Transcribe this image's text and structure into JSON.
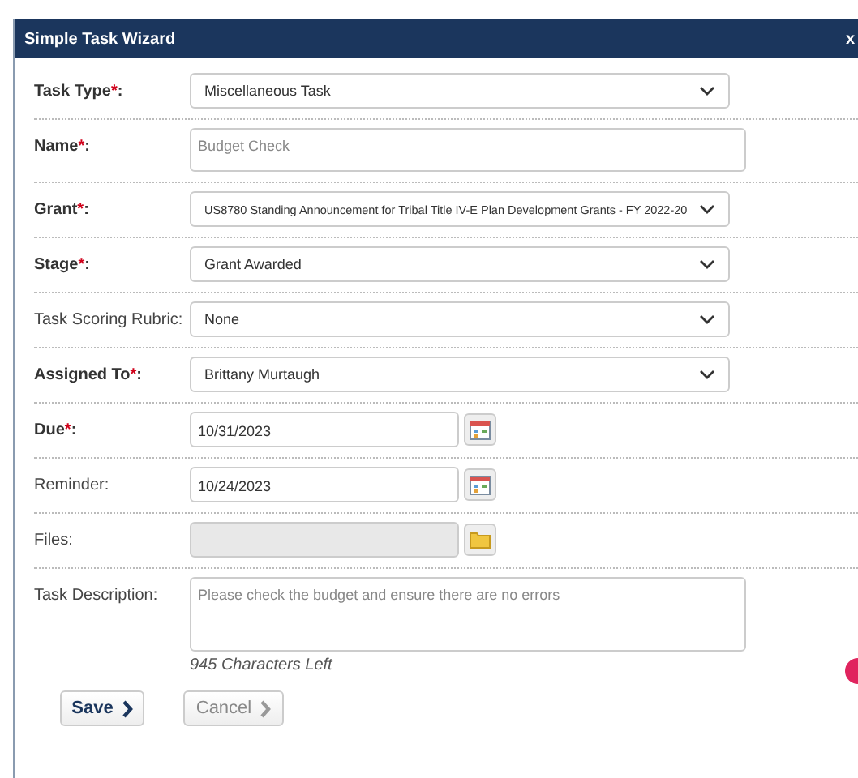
{
  "dialog": {
    "title": "Simple Task Wizard",
    "close": "x"
  },
  "fields": [
    {
      "kind": "select",
      "label": "Task Type",
      "required": true,
      "asterisk": "*",
      "colon": ":",
      "value": "Miscellaneous Task"
    },
    {
      "kind": "textarea",
      "label": "Name",
      "required": true,
      "asterisk": "*",
      "colon": ":",
      "value": "Budget Check"
    },
    {
      "kind": "select",
      "label": "Grant",
      "required": true,
      "asterisk": "*",
      "colon": ":",
      "value": "US8780 Standing Announcement for Tribal Title IV-E Plan Development Grants - FY 2022-20"
    },
    {
      "kind": "select",
      "label": "Stage",
      "required": true,
      "asterisk": "*",
      "colon": ":",
      "value": "Grant Awarded"
    },
    {
      "kind": "select",
      "label": "Task Scoring Rubric:",
      "required": false,
      "value": "None"
    },
    {
      "kind": "select",
      "label": "Assigned To",
      "required": true,
      "asterisk": "*",
      "colon": ":",
      "value": "Brittany Murtaugh"
    },
    {
      "kind": "date",
      "label": "Due",
      "required": true,
      "asterisk": "*",
      "colon": ":",
      "value": "10/31/2023"
    },
    {
      "kind": "date",
      "label": "Reminder:",
      "required": false,
      "value": "10/24/2023"
    },
    {
      "kind": "file",
      "label": "Files:",
      "required": false,
      "disabled": true
    },
    {
      "kind": "description",
      "label": "Task Description:",
      "required": false,
      "value": "Please check the budget and ensure there are no errors",
      "note": "945 Characters Left"
    }
  ],
  "buttons": [
    {
      "label": "Save",
      "disabled": false
    },
    {
      "label": "Cancel",
      "disabled": true
    }
  ]
}
